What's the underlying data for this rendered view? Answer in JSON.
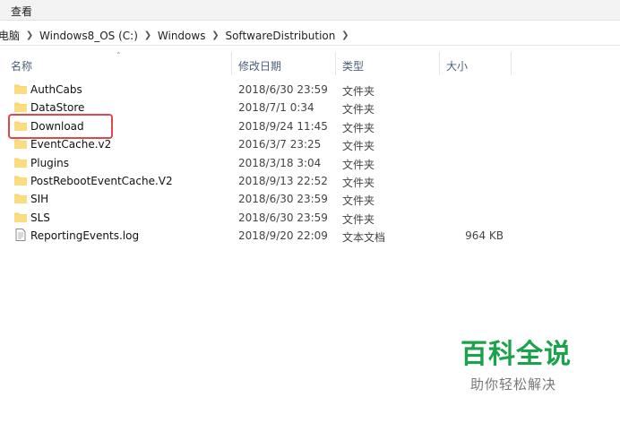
{
  "ribbon": {
    "view_tab": "查看"
  },
  "breadcrumb": [
    "电脑",
    "Windows8_OS (C:)",
    "Windows",
    "SoftwareDistribution"
  ],
  "columns": {
    "name": "名称",
    "date": "修改日期",
    "type": "类型",
    "size": "大小"
  },
  "files": [
    {
      "name": "AuthCabs",
      "date": "2018/6/30 23:59",
      "type": "文件夹",
      "size": "",
      "icon": "folder-icon"
    },
    {
      "name": "DataStore",
      "date": "2018/7/1 0:34",
      "type": "文件夹",
      "size": "",
      "icon": "folder-icon"
    },
    {
      "name": "Download",
      "date": "2018/9/24 11:45",
      "type": "文件夹",
      "size": "",
      "icon": "folder-icon"
    },
    {
      "name": "EventCache.v2",
      "date": "2016/3/7 23:25",
      "type": "文件夹",
      "size": "",
      "icon": "folder-icon"
    },
    {
      "name": "Plugins",
      "date": "2018/3/18 3:04",
      "type": "文件夹",
      "size": "",
      "icon": "folder-icon"
    },
    {
      "name": "PostRebootEventCache.V2",
      "date": "2018/9/13 22:52",
      "type": "文件夹",
      "size": "",
      "icon": "folder-icon"
    },
    {
      "name": "SIH",
      "date": "2018/6/30 23:59",
      "type": "文件夹",
      "size": "",
      "icon": "folder-icon"
    },
    {
      "name": "SLS",
      "date": "2018/6/30 23:59",
      "type": "文件夹",
      "size": "",
      "icon": "folder-icon"
    },
    {
      "name": "ReportingEvents.log",
      "date": "2018/9/20 22:09",
      "type": "文本文档",
      "size": "964 KB",
      "icon": "text-file-icon"
    }
  ],
  "watermark": {
    "title": "百科全说",
    "subtitle": "助你轻松解决"
  },
  "colors": {
    "highlight": "#e0474c",
    "folder": "#f8d775",
    "watermark": "#1aa34a"
  }
}
